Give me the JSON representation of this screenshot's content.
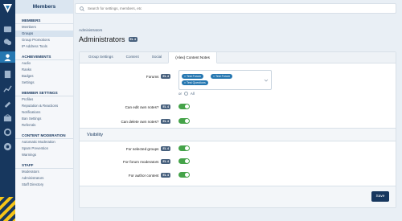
{
  "sidebar": {
    "header": "Members",
    "sections": [
      {
        "title": "MEMBERS",
        "items": [
          "Members",
          "Groups",
          "Group Promotions",
          "IP Address Tools"
        ]
      },
      {
        "title": "ACHIEVEMENTS",
        "items": [
          "Audio",
          "Ranks",
          "Badges",
          "Settings"
        ]
      },
      {
        "title": "MEMBER SETTINGS",
        "items": [
          "Profiles",
          "Reputation & Reactions",
          "Notifications",
          "Ban Settings",
          "Referrals"
        ]
      },
      {
        "title": "CONTENT MODERATION",
        "items": [
          "Automatic Moderation",
          "Spam Prevention",
          "Warnings"
        ]
      },
      {
        "title": "STAFF",
        "items": [
          "Moderators",
          "Administrators",
          "Staff Directory"
        ]
      }
    ]
  },
  "search": {
    "placeholder": "Search for settings, members, etc"
  },
  "breadcrumb": "Administrators",
  "page": {
    "title": "Administrators",
    "badge": "EL 4"
  },
  "tabs": [
    "Group Settings",
    "Content",
    "Social",
    "(Alex) Content Notes"
  ],
  "form": {
    "forums_label": "Forums",
    "forums_badge": "EL 4",
    "chips": [
      "Test Forum",
      "Test Forum",
      "Test Questions"
    ],
    "or_label": "or",
    "all_label": "All",
    "edit_label": "Can edit own notes?",
    "edit_badge": "EL 4",
    "delete_label": "Can delete own notes?",
    "delete_badge": "EL 4"
  },
  "visibility": {
    "title": "Visibility",
    "groups_label": "For selected groups",
    "groups_badge": "EL 4",
    "moderators_label": "For forum moderators",
    "moderators_badge": "EL 4",
    "author_label": "For author content",
    "author_badge": "EL 4"
  },
  "save_label": "Save",
  "colors": {
    "accent": "#2577b1",
    "rail": "#17375e",
    "toggle_on": "#45a349",
    "stripe": "#f5c518"
  }
}
